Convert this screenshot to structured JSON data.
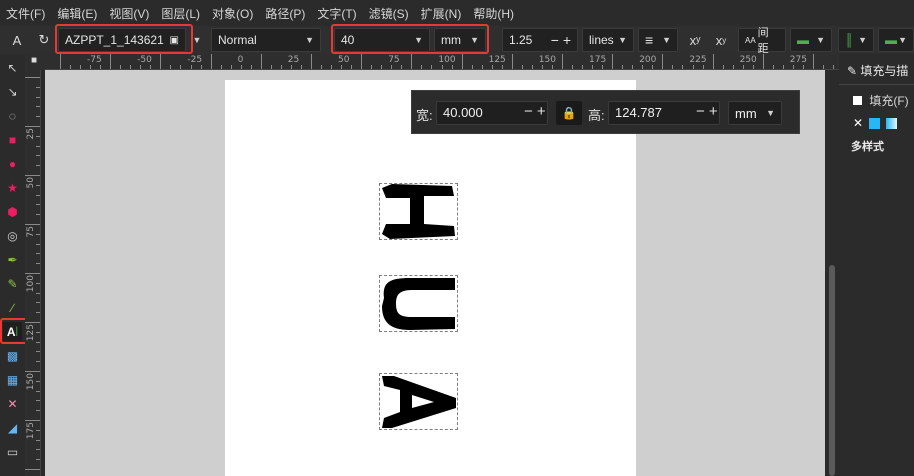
{
  "menu": [
    "文件(F)",
    "编辑(E)",
    "视图(V)",
    "图层(L)",
    "对象(O)",
    "路径(P)",
    "文字(T)",
    "滤镜(S)",
    "扩展(N)",
    "帮助(H)"
  ],
  "toolbar": {
    "font_family": "AZPPT_1_143621",
    "font_style": "Normal",
    "font_size": "40",
    "font_size_unit": "mm",
    "line_spacing": "1.25",
    "line_spacing_unit": "lines",
    "spacing_label": "间距"
  },
  "ruler": {
    "h_labels": [
      "-75",
      "-50",
      "-25",
      "0",
      "25",
      "50",
      "75",
      "100",
      "125",
      "150",
      "175",
      "200",
      "225",
      "250",
      "275"
    ],
    "v_labels": [
      "25",
      "50",
      "75",
      "100",
      "125",
      "150",
      "175"
    ]
  },
  "dimensions": {
    "width_label": "宽:",
    "width_value": "40.000",
    "height_label": "高:",
    "height_value": "124.787",
    "unit": "mm"
  },
  "canvas_text": [
    "H",
    "U",
    "A"
  ],
  "right_panel": {
    "tab_label": "填充与描",
    "fill_label": "填充(F)",
    "multi_style": "多样式"
  }
}
